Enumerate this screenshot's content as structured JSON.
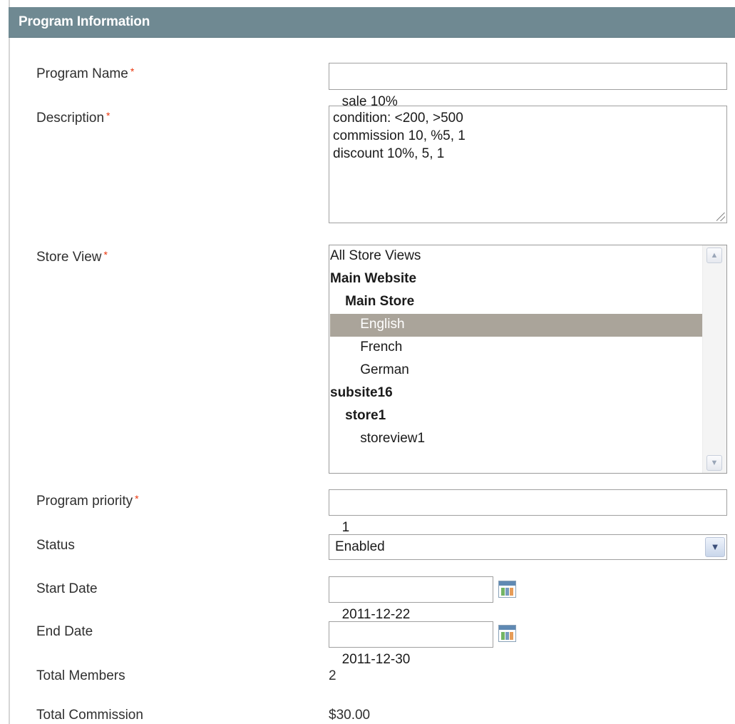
{
  "header": {
    "title": "Program Information"
  },
  "required_mark": "*",
  "fields": {
    "program_name": {
      "label": "Program Name",
      "value": "sale 10%"
    },
    "description": {
      "label": "Description",
      "lines": [
        "condition: <200, >500",
        "commission 10, %5, 1",
        "discount 10%, 5, 1"
      ]
    },
    "store_view": {
      "label": "Store View",
      "options": [
        {
          "text": "All Store Views",
          "indent": "",
          "bold": false,
          "selected": false
        },
        {
          "text": "Main Website",
          "indent": "",
          "bold": true,
          "selected": false
        },
        {
          "text": "Main Store",
          "indent": "    ",
          "bold": true,
          "selected": false
        },
        {
          "text": "English",
          "indent": "        ",
          "bold": false,
          "selected": true
        },
        {
          "text": "French",
          "indent": "        ",
          "bold": false,
          "selected": false
        },
        {
          "text": "German",
          "indent": "        ",
          "bold": false,
          "selected": false
        },
        {
          "text": "subsite16",
          "indent": "",
          "bold": true,
          "selected": false
        },
        {
          "text": "store1",
          "indent": "    ",
          "bold": true,
          "selected": false
        },
        {
          "text": "storeview1",
          "indent": "        ",
          "bold": false,
          "selected": false
        }
      ]
    },
    "priority": {
      "label": "Program priority",
      "value": "1"
    },
    "status": {
      "label": "Status",
      "value": "Enabled"
    },
    "start_date": {
      "label": "Start Date",
      "value": "2011-12-22"
    },
    "end_date": {
      "label": "End Date",
      "value": "2011-12-30"
    },
    "total_members": {
      "label": "Total Members",
      "value": "2"
    },
    "total_commission": {
      "label": "Total Commission",
      "value": "$30.00"
    }
  },
  "icons": {
    "calendar": "calendar-icon",
    "dropdown": "chevron-down-icon",
    "scroll_up": "scroll-up-arrow-icon",
    "scroll_down": "scroll-down-arrow-icon"
  },
  "colors": {
    "header_bg": "#6f8992",
    "required": "#eb340a",
    "selected_option_bg": "#aaa49a"
  }
}
